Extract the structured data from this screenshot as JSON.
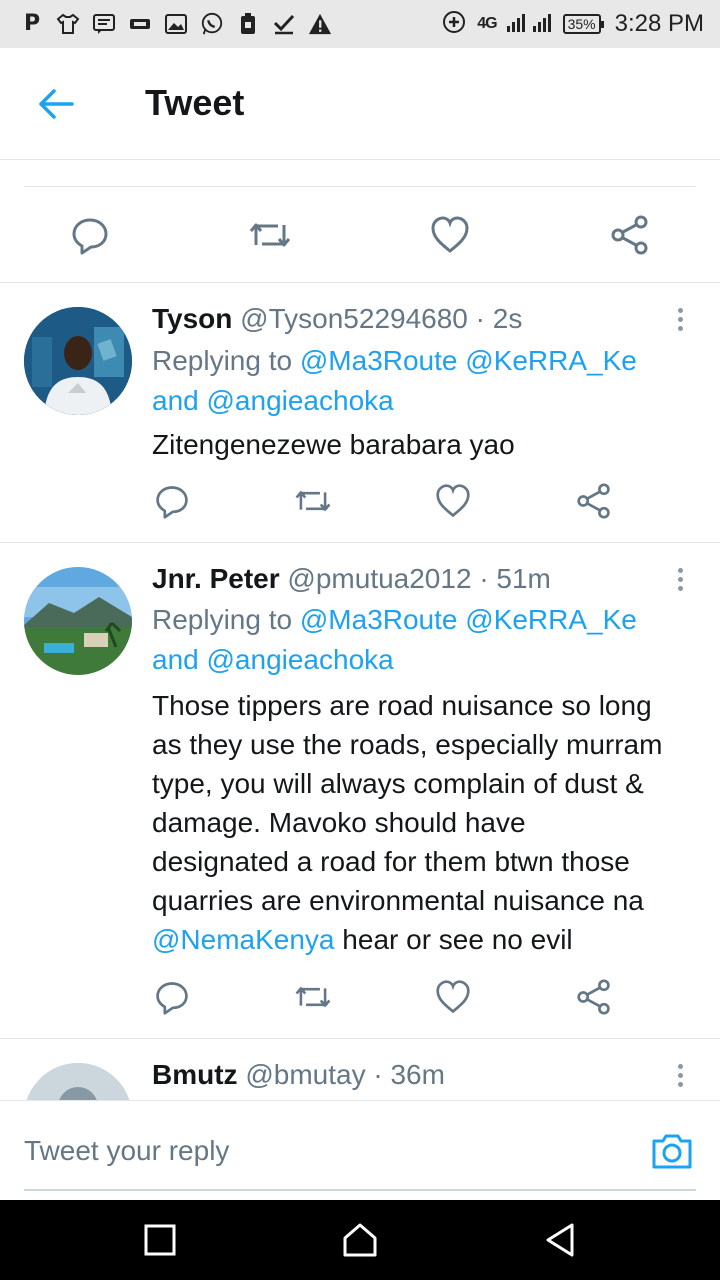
{
  "status_bar": {
    "time": "3:28 PM",
    "battery": "35%",
    "network": "4G",
    "left_icons": [
      "parking-icon",
      "shirt-icon",
      "message-icon",
      "sim-icon",
      "image-icon",
      "whatsapp-icon",
      "lock-icon",
      "check-icon",
      "warning-icon"
    ]
  },
  "header": {
    "title": "Tweet"
  },
  "replies": [
    {
      "name": "Tyson",
      "handle": "@Tyson52294680",
      "time": "· 2s",
      "replying_prefix": "Replying to",
      "replying_to_1": "@Ma3Route @KeRRA_Ke",
      "replying_and": "and",
      "replying_to_2": "@angieachoka",
      "text": "Zitengenezewe barabara yao"
    },
    {
      "name": "Jnr. Peter",
      "handle": "@pmutua2012",
      "time": "· 51m",
      "replying_prefix": "Replying to",
      "replying_to_1": "@Ma3Route @KeRRA_Ke",
      "replying_and": "and",
      "replying_to_2": "@angieachoka",
      "text_line1": "Those tippers are road nuisance so long",
      "text_line2": "as they use the roads, especially murram",
      "text_line3": "type, you will always complain of dust &",
      "text_line4": "damage. Mavoko should have",
      "text_line5": "designated a road for them btwn those",
      "text_line6": "quarries are environmental nuisance na",
      "mention": "@NemaKenya",
      "text_line7_rest": " hear or see no evil"
    },
    {
      "name": "Bmutz",
      "handle": "@bmutay",
      "time": "· 36m"
    }
  ],
  "composer": {
    "placeholder": "Tweet your reply"
  },
  "colors": {
    "accent": "#1da1f2",
    "text": "#14171a",
    "muted": "#657786",
    "icon": "#657786"
  }
}
